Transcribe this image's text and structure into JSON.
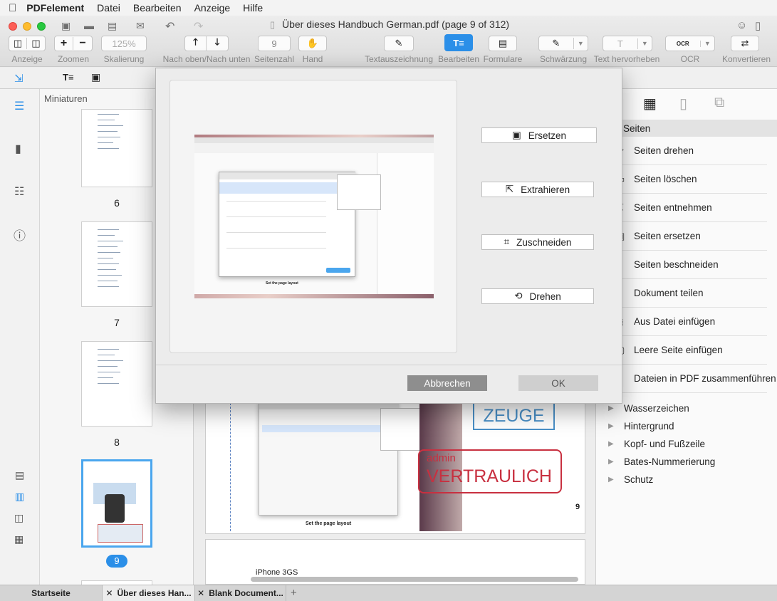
{
  "menu": {
    "apple": "",
    "app": "PDFelement",
    "items": [
      "Datei",
      "Bearbeiten",
      "Anzeige",
      "Hilfe"
    ]
  },
  "window": {
    "title": "Über dieses Handbuch  German.pdf (page 9 of 312)"
  },
  "toolbar": {
    "anzeige": "Anzeige",
    "zoomen": "Zoomen",
    "zoom_plus": "+",
    "zoom_minus": "−",
    "zoom_value": "125%",
    "skalierung": "Skalierung",
    "nav": "Nach oben/Nach unten",
    "page_value": "9",
    "seitenzahl": "Seitenzahl",
    "hand": "Hand",
    "textauszeichnung": "Textauszeichnung",
    "bearbeiten": "Bearbeiten",
    "formulare": "Formulare",
    "schwaerzung": "Schwärzung",
    "text_hervorheben": "Text hervorheben",
    "ocr": "OCR",
    "ocr_icon_text": "OCR",
    "konvertieren": "Konvertieren"
  },
  "thumbs": {
    "header": "Miniaturen",
    "pages": [
      "6",
      "7",
      "8",
      "9"
    ]
  },
  "doc": {
    "stamp1": "ZEUGE",
    "stamp2_top": "admin",
    "stamp2": "VERTRAULICH",
    "page_num": "9",
    "bottom_text": "iPhone 3GS",
    "caption": "Set the page layout"
  },
  "modal": {
    "ersetzen": "Ersetzen",
    "extrahieren": "Extrahieren",
    "zuschneiden": "Zuschneiden",
    "drehen": "Drehen",
    "cancel": "Abbrechen",
    "ok": "OK",
    "inner_caption": "Set the page layout"
  },
  "right": {
    "section": "Seiten",
    "items": [
      "Seiten drehen",
      "Seiten löschen",
      "Seiten entnehmen",
      "Seiten ersetzen",
      "Seiten beschneiden",
      "Dokument teilen",
      "Aus Datei einfügen",
      "Leere Seite einfügen",
      "Dateien in PDF zusammenführen"
    ],
    "sections": [
      "Wasserzeichen",
      "Hintergrund",
      "Kopf- und Fußzeile",
      "Bates-Nummerierung",
      "Schutz"
    ]
  },
  "tabs": [
    "Startseite",
    "Über dieses Han...",
    "Blank Document..."
  ],
  "colors": {
    "accent": "#2b8fe8",
    "stamp_blue": "#4a90c8",
    "stamp_red": "#c83040"
  }
}
